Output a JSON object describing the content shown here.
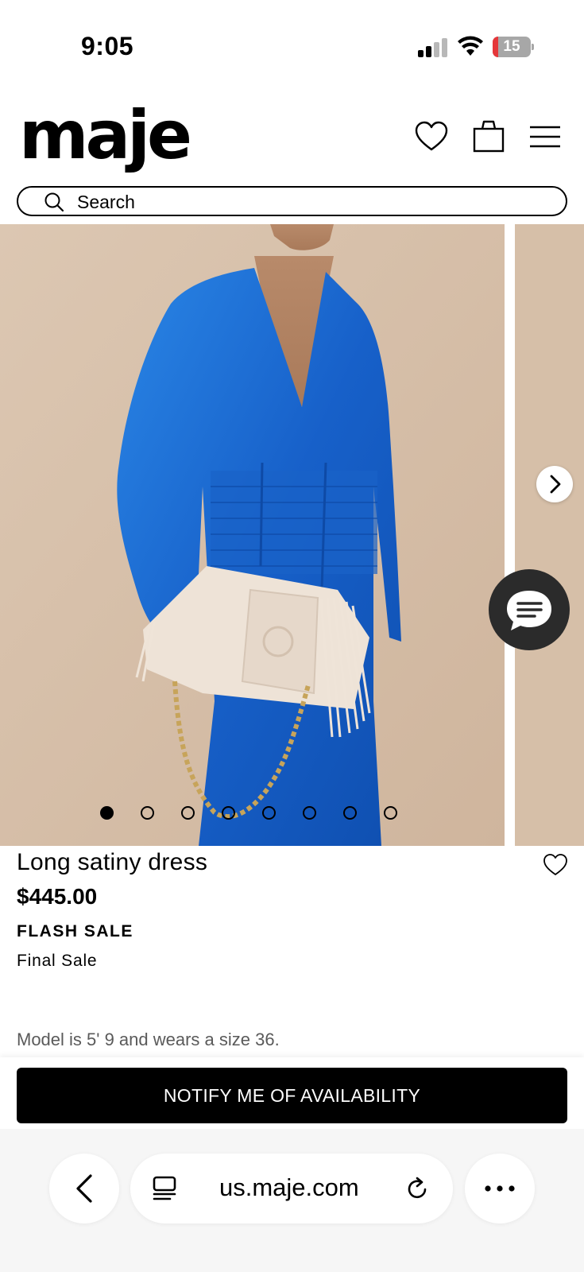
{
  "status_bar": {
    "time": "9:05",
    "battery": "15",
    "battery_level": 0.15
  },
  "header": {
    "logo": "maje",
    "icons": [
      "heart-icon",
      "shopping-bag-icon",
      "menu-icon"
    ]
  },
  "search": {
    "placeholder": "Search"
  },
  "gallery": {
    "image_count": 8,
    "active_index": 0
  },
  "product": {
    "name": "Long satiny dress",
    "price": "$445.00",
    "badge": "FLASH SALE",
    "note": "Final Sale",
    "model_info": "Model is 5' 9 and wears a size 36."
  },
  "cta": {
    "label": "NOTIFY ME OF AVAILABILITY"
  },
  "browser": {
    "url": "us.maje.com"
  },
  "colors": {
    "dress_blue": "#1f6fd1",
    "background_beige": "#d9c2ac",
    "button_black": "#000000",
    "chat_bubble": "#2b2b2b"
  }
}
